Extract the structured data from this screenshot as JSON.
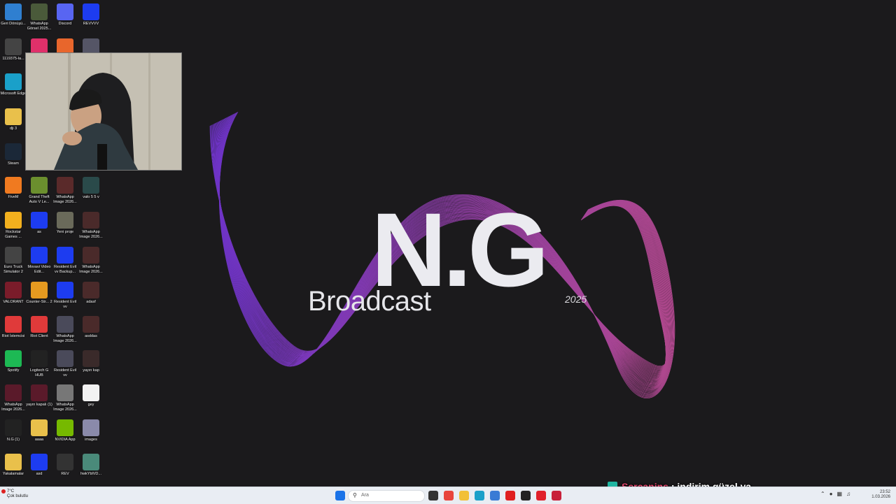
{
  "wallpaper": {
    "title": "N.G",
    "subtitle": "Broadcast",
    "year": "2025",
    "colors": {
      "background": "#1b1a1c",
      "wave_left": "#8a3cff",
      "wave_right": "#e257b4"
    }
  },
  "desktop_icons": [
    {
      "label": "Geri Dönüşü...",
      "icon": "recycle-bin-icon",
      "color": "#2f7fd0"
    },
    {
      "label": "WhatsApp Görsel 2025...",
      "icon": "image-thumbnail-icon",
      "color": "#4a5a3a"
    },
    {
      "label": "Discord",
      "icon": "discord-icon",
      "color": "#5865f2"
    },
    {
      "label": "REVVVV",
      "icon": "app-icon",
      "color": "#1d3cf0"
    },
    {
      "label": "1119375-la...",
      "icon": "image-thumbnail-icon",
      "color": "#444"
    },
    {
      "label": "",
      "icon": "app-icon",
      "color": "#e0306a"
    },
    {
      "label": "",
      "icon": "app-icon",
      "color": "#e8662c"
    },
    {
      "label": "",
      "icon": "image-thumbnail-icon",
      "color": "#556"
    },
    {
      "label": "Microsoft Edge",
      "icon": "edge-icon",
      "color": "#1aa0c9"
    },
    {
      "label": "dji 3",
      "icon": "folder-icon",
      "color": "#e9c04b"
    },
    {
      "label": "Steam",
      "icon": "steam-icon",
      "color": "#1b2838"
    },
    {
      "label": "FiveM",
      "icon": "fivem-icon",
      "color": "#f07a20"
    },
    {
      "label": "Grand Theft Auto V Le...",
      "icon": "gta-icon",
      "color": "#6b8f2e"
    },
    {
      "label": "WhatsApp Image 2026...",
      "icon": "image-thumbnail-icon",
      "color": "#5a2a2a"
    },
    {
      "label": "valo 5 5 v",
      "icon": "image-thumbnail-icon",
      "color": "#2a4a4a"
    },
    {
      "label": "Rockstar Games ...",
      "icon": "rockstar-icon",
      "color": "#f2b01e"
    },
    {
      "label": "as",
      "icon": "app-icon",
      "color": "#1d3cf0"
    },
    {
      "label": "Yeni proje",
      "icon": "image-thumbnail-icon",
      "color": "#6a6a5a"
    },
    {
      "label": "WhatsApp Image 2026...",
      "icon": "image-thumbnail-icon",
      "color": "#4a2a2a"
    },
    {
      "label": "Euro Truck Simulator 2",
      "icon": "ets2-icon",
      "color": "#444"
    },
    {
      "label": "Movavi Video Edit...",
      "icon": "app-icon",
      "color": "#1d3cf0"
    },
    {
      "label": "Resident Evil vv Backup...",
      "icon": "app-icon",
      "color": "#1d3cf0"
    },
    {
      "label": "WhatsApp Image 2026...",
      "icon": "image-thumbnail-icon",
      "color": "#4a2a2a"
    },
    {
      "label": "VALORANT",
      "icon": "valorant-icon",
      "color": "#7a1c2a"
    },
    {
      "label": "Counter-Str... 2",
      "icon": "cs2-icon",
      "color": "#e59a20"
    },
    {
      "label": "Resident Evil vv",
      "icon": "app-icon",
      "color": "#1d3cf0"
    },
    {
      "label": "adasf",
      "icon": "image-thumbnail-icon",
      "color": "#4a2a2a"
    },
    {
      "label": "Riot İstemcisi",
      "icon": "riot-icon",
      "color": "#e03a3a"
    },
    {
      "label": "Riot Client",
      "icon": "riot-icon",
      "color": "#e03a3a"
    },
    {
      "label": "WhatsApp Image 2026...",
      "icon": "image-thumbnail-icon",
      "color": "#4a4a5a"
    },
    {
      "label": "asddas",
      "icon": "image-thumbnail-icon",
      "color": "#4a2a2a"
    },
    {
      "label": "Spotify",
      "icon": "spotify-icon",
      "color": "#1db954"
    },
    {
      "label": "Logitech G HUB",
      "icon": "logitech-icon",
      "color": "#222"
    },
    {
      "label": "Resident Evil vv",
      "icon": "image-thumbnail-icon",
      "color": "#4a4a5a"
    },
    {
      "label": "yayın kap",
      "icon": "image-thumbnail-icon",
      "color": "#3a2a2a"
    },
    {
      "label": "WhatsApp Image 2026...",
      "icon": "image-thumbnail-icon",
      "color": "#5a1a2a"
    },
    {
      "label": "yayın kapalı (1)",
      "icon": "image-thumbnail-icon",
      "color": "#5a1a2a"
    },
    {
      "label": "WhatsApp Image 2026...",
      "icon": "image-thumbnail-icon",
      "color": "#777"
    },
    {
      "label": "gey",
      "icon": "media-file-icon",
      "color": "#f2f2f2"
    },
    {
      "label": "N.G (1)",
      "icon": "image-thumbnail-icon",
      "color": "#222"
    },
    {
      "label": "aaaa",
      "icon": "folder-icon",
      "color": "#e9c04b"
    },
    {
      "label": "NVIDIA App",
      "icon": "nvidia-icon",
      "color": "#76b900"
    },
    {
      "label": "images",
      "icon": "image-thumbnail-icon",
      "color": "#8a8aaa"
    },
    {
      "label": "Yakalamalar",
      "icon": "folder-icon",
      "color": "#e9c04b"
    },
    {
      "label": "asd",
      "icon": "app-icon",
      "color": "#1d3cf0"
    },
    {
      "label": "REV",
      "icon": "image-thumbnail-icon",
      "color": "#333"
    },
    {
      "label": "hwkYblVD...",
      "icon": "image-thumbnail-icon",
      "color": "#4a8a7a"
    }
  ],
  "taskbar": {
    "weather_temp": "7°C",
    "weather_desc": "Çok bulutlu",
    "search_placeholder": "Ara",
    "time": "23:52",
    "date": "1.03.2026",
    "apps": [
      {
        "icon": "windows-start-icon",
        "color": "#1a73e8"
      },
      {
        "icon": "search-highlight-icon",
        "color": "#c9b48a"
      },
      {
        "icon": "task-view-icon",
        "color": "#333"
      },
      {
        "icon": "chrome-icon",
        "color": "#e8453c"
      },
      {
        "icon": "file-explorer-icon",
        "color": "#f2c037"
      },
      {
        "icon": "edge-icon",
        "color": "#1aa0c9"
      },
      {
        "icon": "store-icon",
        "color": "#3a7bd5"
      },
      {
        "icon": "youtube-icon",
        "color": "#e02020"
      },
      {
        "icon": "obs-icon",
        "color": "#222"
      },
      {
        "icon": "opera-icon",
        "color": "#e0202a"
      },
      {
        "icon": "app-icon",
        "color": "#c8203a"
      }
    ]
  },
  "chat_overlay": {
    "username": "Sercanins",
    "separator": " : ",
    "message": "indirim güzel ya"
  }
}
